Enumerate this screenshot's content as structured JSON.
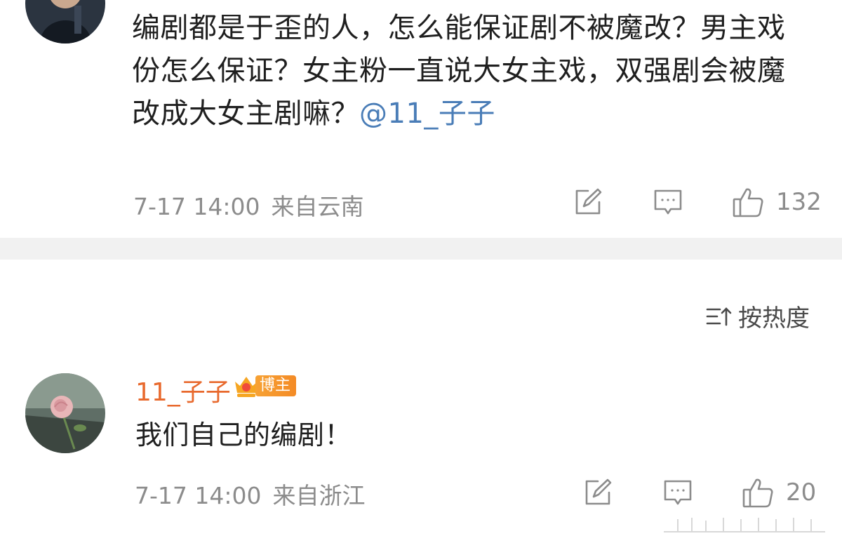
{
  "comment1": {
    "text_main": "编剧都是于歪的人，怎么能保证剧不被魔改？男主戏份怎么保证？女主粉一直说大女主戏，双强剧会被魔改成大女主剧嘛？",
    "mention": "@11_子子",
    "time": "7-17 14:00",
    "location": "来自云南",
    "like_count": "132"
  },
  "sort": {
    "label": "按热度"
  },
  "comment2": {
    "username": "11_子子",
    "badge": "博主",
    "text": "我们自己的编剧！",
    "time": "7-17 14:00",
    "location": "来自浙江",
    "like_count": "20"
  },
  "icons": [
    "share-icon",
    "comment-icon",
    "like-icon",
    "sort-icon",
    "vip-crown-icon"
  ],
  "colors": {
    "mention": "#4a7db7",
    "username": "#e8692d",
    "badge": "#f59a2e",
    "meta": "#8c8c8c",
    "divider": "#f1f1f1"
  }
}
